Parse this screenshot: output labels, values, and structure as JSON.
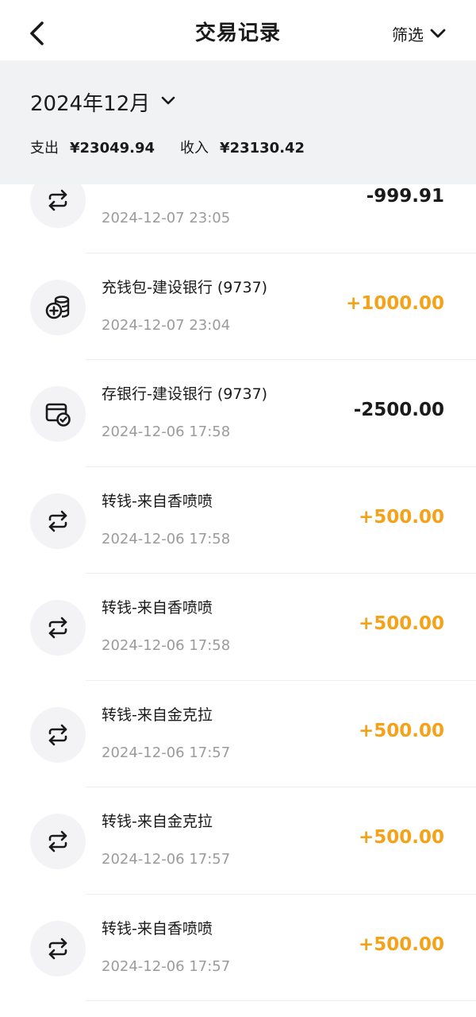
{
  "header": {
    "title": "交易记录",
    "back_icon": "chevron-left-icon",
    "filter_label": "筛选",
    "filter_icon": "chevron-down-icon"
  },
  "summary": {
    "month": "2024年12月",
    "expense_label": "支出",
    "expense_value": "¥23049.94",
    "income_label": "收入",
    "income_value": "¥23130.42"
  },
  "colors": {
    "income": "#f3a21a",
    "expense": "#1a1a1a",
    "summary_bg": "#f1f2f4",
    "icon_bg": "#f3f3f5"
  },
  "transactions": [
    {
      "name": "",
      "time": "2024-12-07 23:05",
      "amount": "-999.91",
      "type": "expense",
      "icon": "transfer-icon"
    },
    {
      "name": "充钱包-建设银行 (9737)",
      "time": "2024-12-07 23:04",
      "amount": "+1000.00",
      "type": "income",
      "icon": "coins-add-icon"
    },
    {
      "name": "存银行-建设银行 (9737)",
      "time": "2024-12-06 17:58",
      "amount": "-2500.00",
      "type": "expense",
      "icon": "card-check-icon"
    },
    {
      "name": "转钱-来自香喷喷",
      "time": "2024-12-06 17:58",
      "amount": "+500.00",
      "type": "income",
      "icon": "transfer-icon"
    },
    {
      "name": "转钱-来自香喷喷",
      "time": "2024-12-06 17:58",
      "amount": "+500.00",
      "type": "income",
      "icon": "transfer-icon"
    },
    {
      "name": "转钱-来自金克拉",
      "time": "2024-12-06 17:57",
      "amount": "+500.00",
      "type": "income",
      "icon": "transfer-icon"
    },
    {
      "name": "转钱-来自金克拉",
      "time": "2024-12-06 17:57",
      "amount": "+500.00",
      "type": "income",
      "icon": "transfer-icon"
    },
    {
      "name": "转钱-来自香喷喷",
      "time": "2024-12-06 17:57",
      "amount": "+500.00",
      "type": "income",
      "icon": "transfer-icon"
    }
  ]
}
